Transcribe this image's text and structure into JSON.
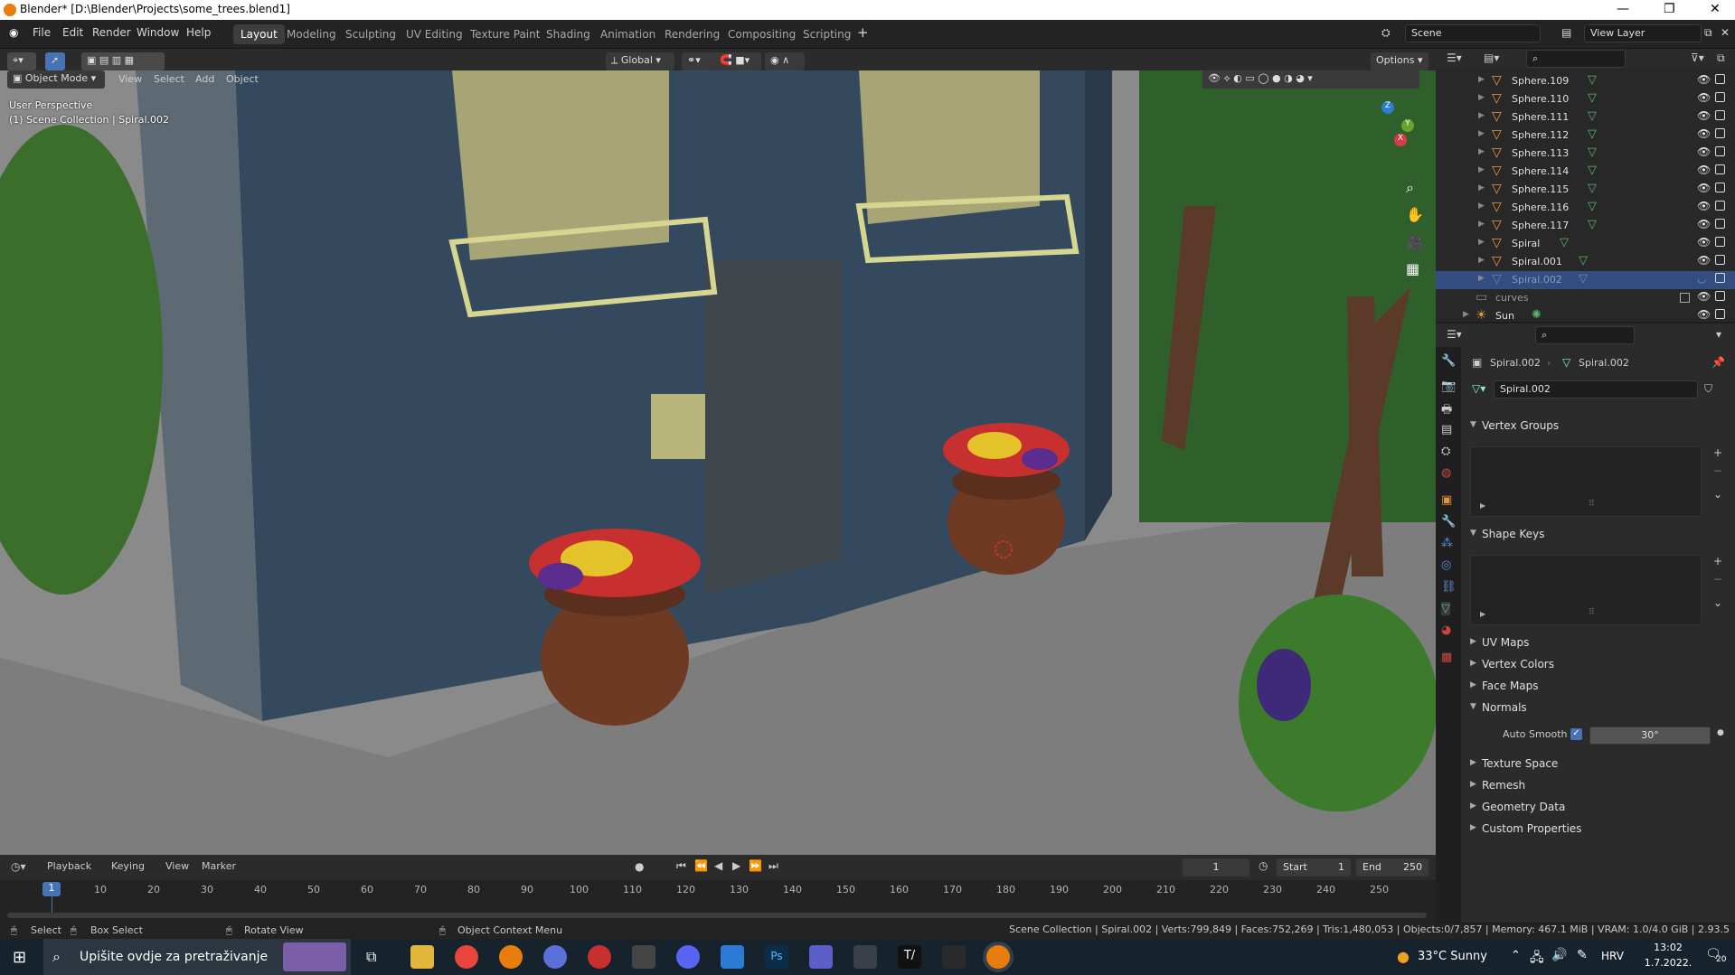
{
  "window": {
    "title": "Blender* [D:\\Blender\\Projects\\some_trees.blend1]"
  },
  "menu": {
    "items": [
      "File",
      "Edit",
      "Render",
      "Window",
      "Help"
    ]
  },
  "workspaces": [
    "Layout",
    "Modeling",
    "Sculpting",
    "UV Editing",
    "Texture Paint",
    "Shading",
    "Animation",
    "Rendering",
    "Compositing",
    "Scripting"
  ],
  "scene": {
    "name": "Scene",
    "view_layer": "View Layer"
  },
  "viewport": {
    "mode": "Object Mode",
    "menus": [
      "View",
      "Select",
      "Add",
      "Object"
    ],
    "orientation": "Global",
    "options_label": "Options",
    "perspective": "User Perspective",
    "context": "(1) Scene Collection | Spiral.002",
    "gizmo_axes": [
      "Z",
      "Y",
      "X"
    ]
  },
  "outliner": {
    "rows": [
      {
        "label": "Sphere.109",
        "selected": false
      },
      {
        "label": "Sphere.110",
        "selected": false
      },
      {
        "label": "Sphere.111",
        "selected": false
      },
      {
        "label": "Sphere.112",
        "selected": false
      },
      {
        "label": "Sphere.113",
        "selected": false
      },
      {
        "label": "Sphere.114",
        "selected": false
      },
      {
        "label": "Sphere.115",
        "selected": false
      },
      {
        "label": "Sphere.116",
        "selected": false
      },
      {
        "label": "Sphere.117",
        "selected": false
      },
      {
        "label": "Spiral",
        "selected": false
      },
      {
        "label": "Spiral.001",
        "selected": false
      },
      {
        "label": "Spiral.002",
        "selected": true
      },
      {
        "label": "curves",
        "selected": false
      },
      {
        "label": "Sun",
        "selected": false
      }
    ]
  },
  "properties": {
    "breadcrumb_object": "Spiral.002",
    "breadcrumb_data": "Spiral.002",
    "data_name": "Spiral.002",
    "panels": [
      {
        "label": "Vertex Groups",
        "open": true
      },
      {
        "label": "Shape Keys",
        "open": true
      },
      {
        "label": "UV Maps",
        "open": false
      },
      {
        "label": "Vertex Colors",
        "open": false
      },
      {
        "label": "Face Maps",
        "open": false
      },
      {
        "label": "Normals",
        "open": true
      },
      {
        "label": "Texture Space",
        "open": false
      },
      {
        "label": "Remesh",
        "open": false
      },
      {
        "label": "Geometry Data",
        "open": false
      },
      {
        "label": "Custom Properties",
        "open": false
      }
    ],
    "auto_smooth_label": "Auto Smooth",
    "auto_smooth_checked": true,
    "auto_smooth_angle": "30°"
  },
  "timeline": {
    "menus": [
      "Playback",
      "Keying",
      "View",
      "Marker"
    ],
    "current_frame": "1",
    "start_label": "Start",
    "start": "1",
    "end_label": "End",
    "end": "250",
    "ticks": [
      "1",
      "10",
      "20",
      "30",
      "40",
      "50",
      "60",
      "70",
      "80",
      "90",
      "100",
      "110",
      "120",
      "130",
      "140",
      "150",
      "160",
      "170",
      "180",
      "190",
      "200",
      "210",
      "220",
      "230",
      "240",
      "250"
    ]
  },
  "statusbar": {
    "select": "Select",
    "box_select": "Box Select",
    "rotate": "Rotate View",
    "context_menu": "Object Context Menu",
    "stats": "Scene Collection | Spiral.002 | Verts:799,849 | Faces:752,269 | Tris:1,480,053 | Objects:0/7,857 | Memory: 467.1 MiB | VRAM: 1.0/4.0 GiB | 2.93.5"
  },
  "taskbar": {
    "search_placeholder": "Upišite ovdje za pretraživanje",
    "weather": "33°C  Sunny",
    "language": "HRV",
    "time": "13:02",
    "date": "1.7.2022.",
    "notifications": "20"
  }
}
